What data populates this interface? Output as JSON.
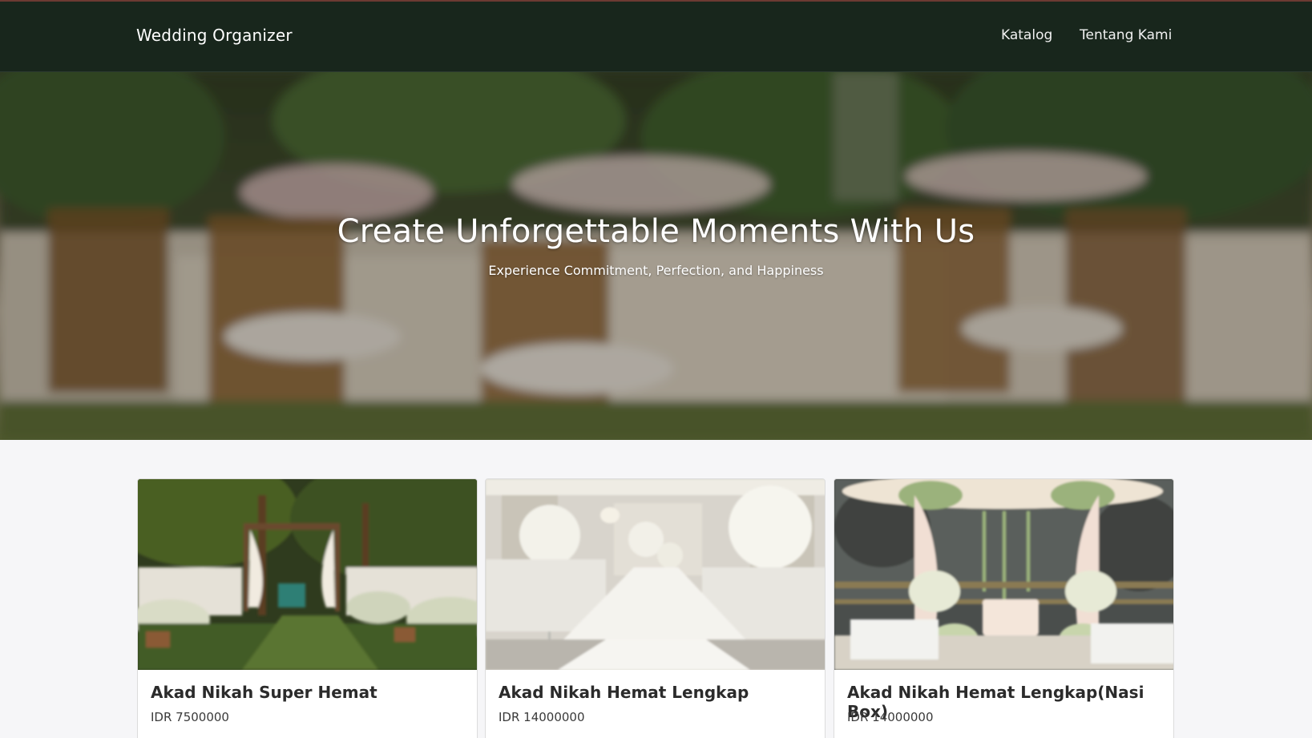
{
  "navbar": {
    "brand": "Wedding Organizer",
    "links": [
      {
        "label": "Katalog"
      },
      {
        "label": "Tentang Kami"
      }
    ]
  },
  "hero": {
    "title": "Create Unforgettable Moments With Us",
    "subtitle": "Experience Commitment, Perfection, and Happiness"
  },
  "catalog": {
    "items": [
      {
        "title": "Akad Nikah Super Hemat",
        "price": "IDR 7500000"
      },
      {
        "title": "Akad Nikah Hemat Lengkap",
        "price": "IDR 14000000"
      },
      {
        "title": "Akad Nikah Hemat Lengkap(Nasi Box)",
        "price": "IDR 14000000"
      }
    ]
  },
  "colors": {
    "navbar_bg": "#18261c",
    "page_bg": "#f6f6f8",
    "top_accent": "#6d3a32"
  }
}
